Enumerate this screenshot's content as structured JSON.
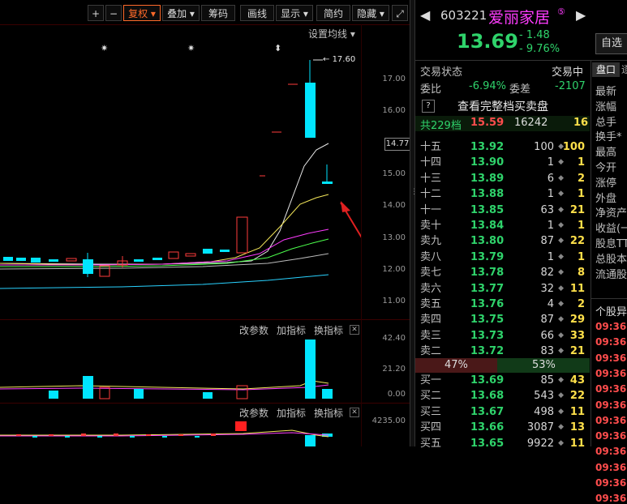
{
  "toolbar": {
    "plus": "+",
    "minus": "−",
    "fuquan": "复权",
    "diejia": "叠加",
    "chouma": "筹码",
    "huaxian": "画线",
    "xianshi": "显示",
    "jianyue": "简约",
    "yincang": "隐藏",
    "expand": "⤢"
  },
  "chart": {
    "settings_label": "设置均线",
    "peak_label": "17.60",
    "current_price_tag": "14.77",
    "axis": [
      "17.00",
      "16.00",
      "15.00",
      "14.00",
      "13.00",
      "12.00",
      "11.00",
      "10.00"
    ],
    "stars": [
      "✷",
      "✷",
      "⬍"
    ]
  },
  "volume_panel": {
    "link1": "改参数",
    "link2": "加指标",
    "link3": "换指标",
    "axis": [
      "42.40",
      "21.20",
      "0.00"
    ]
  },
  "macd_panel": {
    "link1": "改参数",
    "link2": "加指标",
    "link3": "换指标",
    "axis_top": "4235.00"
  },
  "stock": {
    "code": "603221",
    "name": "爱丽家居",
    "badge": "⑤",
    "price": "13.69",
    "change": "1.48",
    "change_pct": "9.76%",
    "watch_btn": "自选"
  },
  "status": {
    "label": "交易状态",
    "value": "交易中",
    "weibi_label": "委比",
    "weibi": "-6.94%",
    "weicha_label": "委差",
    "weicha": "-2107",
    "help": "?",
    "full_book": "查看完整档买卖盘",
    "total_label": "共229档",
    "total_price": "15.59",
    "total_qty": "16242",
    "total_n": "16"
  },
  "sell_rows": [
    {
      "name": "十五",
      "price": "13.92",
      "qty": "100",
      "n": "100"
    },
    {
      "name": "十四",
      "price": "13.90",
      "qty": "1",
      "n": "1"
    },
    {
      "name": "十三",
      "price": "13.89",
      "qty": "6",
      "n": "2"
    },
    {
      "name": "十二",
      "price": "13.88",
      "qty": "1",
      "n": "1"
    },
    {
      "name": "十一",
      "price": "13.85",
      "qty": "63",
      "n": "21"
    },
    {
      "name": "卖十",
      "price": "13.84",
      "qty": "1",
      "n": "1"
    },
    {
      "name": "卖九",
      "price": "13.80",
      "qty": "87",
      "n": "22"
    },
    {
      "name": "卖八",
      "price": "13.79",
      "qty": "1",
      "n": "1"
    },
    {
      "name": "卖七",
      "price": "13.78",
      "qty": "82",
      "n": "8"
    },
    {
      "name": "卖六",
      "price": "13.77",
      "qty": "32",
      "n": "11"
    },
    {
      "name": "卖五",
      "price": "13.76",
      "qty": "4",
      "n": "2"
    },
    {
      "name": "卖四",
      "price": "13.75",
      "qty": "87",
      "n": "29"
    },
    {
      "name": "卖三",
      "price": "13.73",
      "qty": "66",
      "n": "33"
    },
    {
      "name": "卖二",
      "price": "13.72",
      "qty": "83",
      "n": "21"
    },
    {
      "name": "卖一",
      "price": "13.71",
      "qty": "146",
      "n": "49"
    }
  ],
  "ratio": {
    "sell": "47%",
    "buy": "53%"
  },
  "buy_rows": [
    {
      "name": "买一",
      "price": "13.69",
      "qty": "85",
      "n": "43"
    },
    {
      "name": "买二",
      "price": "13.68",
      "qty": "543",
      "n": "22"
    },
    {
      "name": "买三",
      "price": "13.67",
      "qty": "498",
      "n": "11"
    },
    {
      "name": "买四",
      "price": "13.66",
      "qty": "3087",
      "n": "13"
    },
    {
      "name": "买五",
      "price": "13.65",
      "qty": "9922",
      "n": "11"
    }
  ],
  "side": {
    "tab1": "盘口",
    "tab2": "逐",
    "items": [
      "最新",
      "涨幅",
      "总手",
      "换手*",
      "最高",
      "今开",
      "涨停",
      "外盘",
      "净资产",
      "收益(一",
      "股息TT",
      "总股本",
      "流通股"
    ],
    "section": "个股异",
    "times": [
      "09:36",
      "09:36",
      "09:36",
      "09:36",
      "09:36",
      "09:36",
      "09:36",
      "09:36",
      "09:36",
      "09:36",
      "09:36",
      "09:36"
    ]
  },
  "colors": {
    "up": "#ff3b3b",
    "down": "#00e5ff",
    "green": "#2fd36b",
    "yellow": "#ffe04a"
  }
}
